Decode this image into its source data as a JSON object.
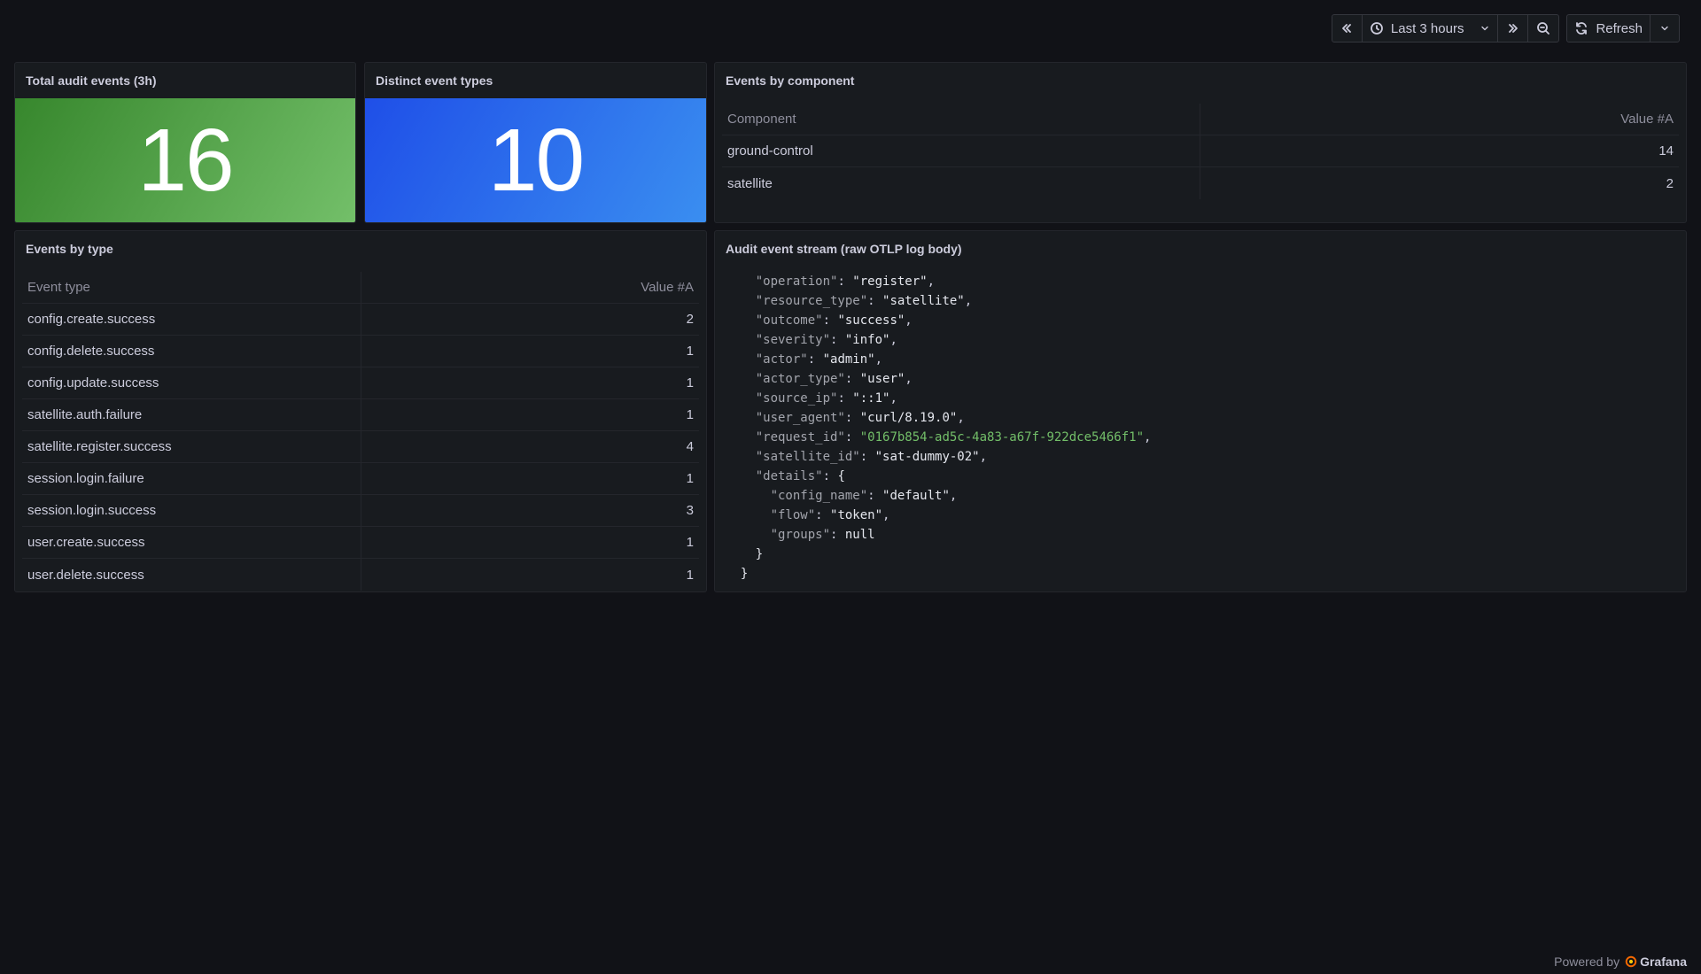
{
  "toolbar": {
    "time_range": "Last 3 hours",
    "refresh_label": "Refresh"
  },
  "panels": {
    "total_events": {
      "title": "Total audit events (3h)",
      "value": "16",
      "color_from": "#37872d",
      "color_to": "#73bf69"
    },
    "distinct_types": {
      "title": "Distinct event types",
      "value": "10",
      "color_from": "#1f4fe8",
      "color_to": "#3a8ef0"
    },
    "by_component": {
      "title": "Events by component",
      "columns": [
        "Component",
        "Value #A"
      ],
      "rows": [
        [
          "ground-control",
          "14"
        ],
        [
          "satellite",
          "2"
        ]
      ]
    },
    "by_type": {
      "title": "Events by type",
      "columns": [
        "Event type",
        "Value #A"
      ],
      "rows": [
        [
          "config.create.success",
          "2"
        ],
        [
          "config.delete.success",
          "1"
        ],
        [
          "config.update.success",
          "1"
        ],
        [
          "satellite.auth.failure",
          "1"
        ],
        [
          "satellite.register.success",
          "4"
        ],
        [
          "session.login.failure",
          "1"
        ],
        [
          "session.login.success",
          "3"
        ],
        [
          "user.create.success",
          "1"
        ],
        [
          "user.delete.success",
          "1"
        ]
      ]
    },
    "stream": {
      "title": "Audit event stream (raw OTLP log body)",
      "lines": [
        {
          "indent": "    ",
          "key": "\"operation\"",
          "value": "\"register\"",
          "tail": ",",
          "green": false
        },
        {
          "indent": "    ",
          "key": "\"resource_type\"",
          "value": "\"satellite\"",
          "tail": ",",
          "green": false
        },
        {
          "indent": "    ",
          "key": "\"outcome\"",
          "value": "\"success\"",
          "tail": ",",
          "green": false
        },
        {
          "indent": "    ",
          "key": "\"severity\"",
          "value": "\"info\"",
          "tail": ",",
          "green": false
        },
        {
          "indent": "    ",
          "key": "\"actor\"",
          "value": "\"admin\"",
          "tail": ",",
          "green": false
        },
        {
          "indent": "    ",
          "key": "\"actor_type\"",
          "value": "\"user\"",
          "tail": ",",
          "green": false
        },
        {
          "indent": "    ",
          "key": "\"source_ip\"",
          "value": "\"::1\"",
          "tail": ",",
          "green": false
        },
        {
          "indent": "    ",
          "key": "\"user_agent\"",
          "value": "\"curl/8.19.0\"",
          "tail": ",",
          "green": false
        },
        {
          "indent": "    ",
          "key": "\"request_id\"",
          "value": "\"0167b854-ad5c-4a83-a67f-922dce5466f1\"",
          "tail": ",",
          "green": true
        },
        {
          "indent": "    ",
          "key": "\"satellite_id\"",
          "value": "\"sat-dummy-02\"",
          "tail": ",",
          "green": false
        },
        {
          "indent": "    ",
          "key": "\"details\"",
          "value": "{",
          "tail": "",
          "green": false
        },
        {
          "indent": "      ",
          "key": "\"config_name\"",
          "value": "\"default\"",
          "tail": ",",
          "green": false
        },
        {
          "indent": "      ",
          "key": "\"flow\"",
          "value": "\"token\"",
          "tail": ",",
          "green": false
        },
        {
          "indent": "      ",
          "key": "\"groups\"",
          "value": "null",
          "tail": "",
          "green": false
        },
        {
          "indent": "    ",
          "key": "",
          "value": "}",
          "tail": "",
          "green": false
        },
        {
          "indent": "  ",
          "key": "",
          "value": "}",
          "tail": "",
          "green": false
        }
      ]
    }
  },
  "footer": {
    "powered_by": "Powered by",
    "brand": "Grafana"
  }
}
